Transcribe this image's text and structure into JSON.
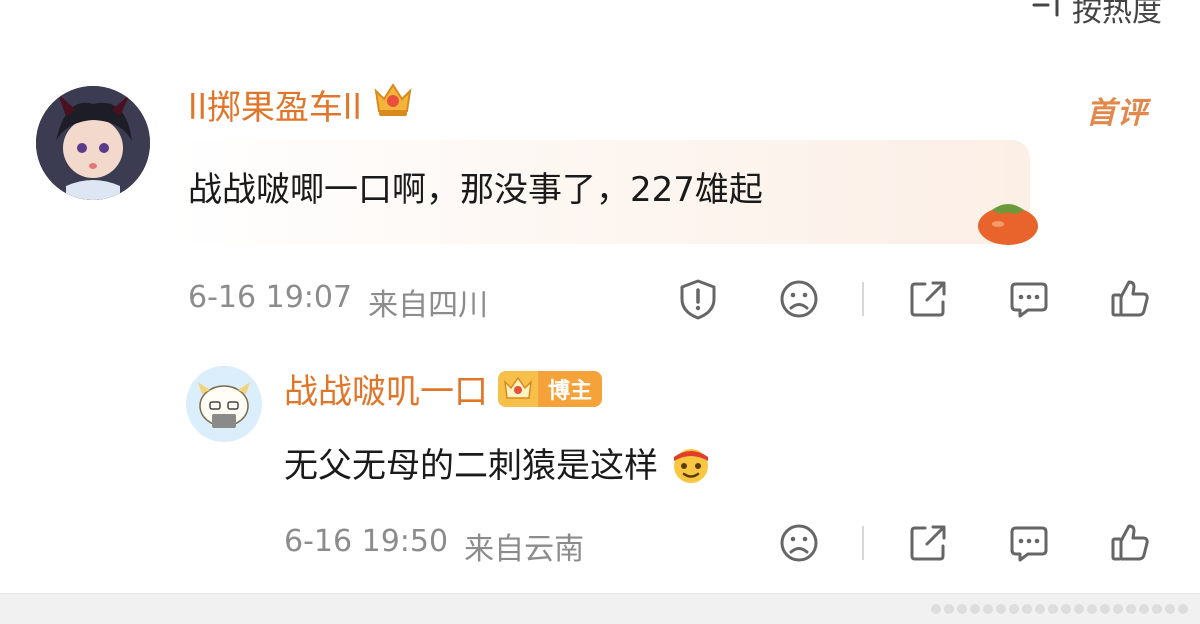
{
  "sort": {
    "label": "按热度"
  },
  "comments": [
    {
      "username": "ll掷果盈车ll",
      "text": "战战啵唧一口啊，那没事了，227雄起",
      "timestamp": "6-16 19:07",
      "location": "来自四川",
      "badge": "首评",
      "actions": [
        "report-icon",
        "dislike-icon",
        "share-icon",
        "reply-icon",
        "like-icon"
      ]
    },
    {
      "username": "战战啵叽一口",
      "role_badge": "博主",
      "text": "无父无母的二刺猿是这样",
      "timestamp": "6-16 19:50",
      "location": "来自云南",
      "actions": [
        "dislike-icon",
        "share-icon",
        "reply-icon",
        "like-icon"
      ]
    }
  ],
  "colors": {
    "username": "#e0762a",
    "meta": "#8c8c8c",
    "text": "#1a1a1a",
    "badge": "#f6a23a"
  }
}
